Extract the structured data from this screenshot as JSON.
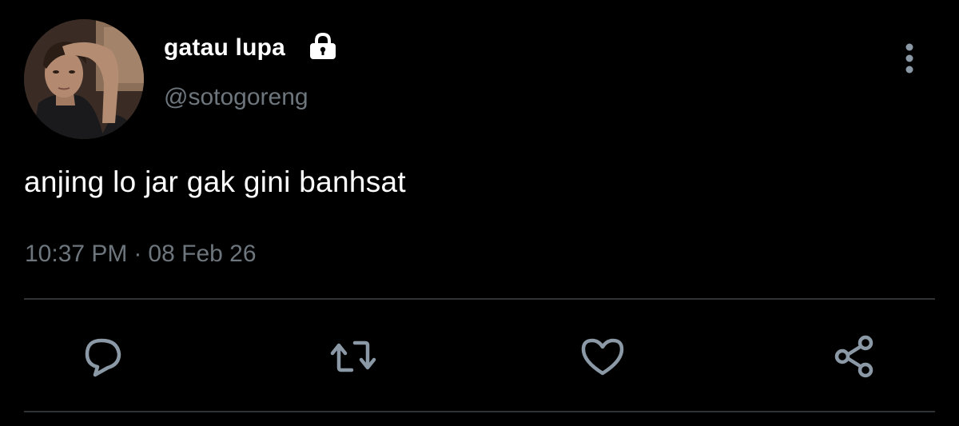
{
  "tweet": {
    "display_name": "gatau lupa",
    "handle": "@sotogoreng",
    "text": "anjing lo jar gak gini banhsat",
    "time": "10:37 PM",
    "separator": "·",
    "date": "08 Feb 26",
    "protected_icon": "lock-icon",
    "avatar": "profile-photo"
  },
  "actions": [
    {
      "name": "reply",
      "icon": "speech-bubble-icon"
    },
    {
      "name": "retweet",
      "icon": "retweet-arrows-icon"
    },
    {
      "name": "like",
      "icon": "heart-icon"
    },
    {
      "name": "share",
      "icon": "share-nodes-icon"
    }
  ],
  "colors": {
    "background": "#000000",
    "primary_text": "#ffffff",
    "secondary_text": "#6e767d",
    "icon": "#8b98a5",
    "divider": "#2f3336"
  }
}
